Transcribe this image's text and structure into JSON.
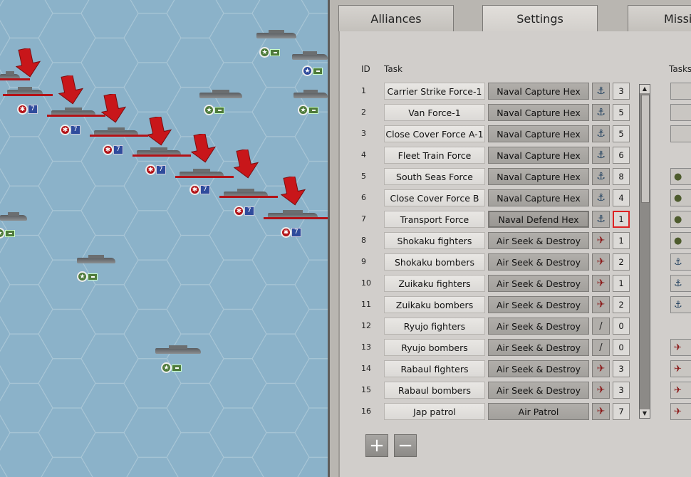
{
  "tabs": [
    "Alliances",
    "Settings",
    "Missi"
  ],
  "table": {
    "col_id": "ID",
    "col_task": "Task",
    "col_tasks_right": "Tasks",
    "rows": [
      {
        "id": "1",
        "name": "Carrier Strike Force-1",
        "type": "Naval Capture Hex",
        "icon": "anchor-icon",
        "count": "3"
      },
      {
        "id": "2",
        "name": "Van Force-1",
        "type": "Naval Capture Hex",
        "icon": "anchor-icon",
        "count": "5"
      },
      {
        "id": "3",
        "name": "Close Cover Force A-1",
        "type": "Naval Capture Hex",
        "icon": "anchor-icon",
        "count": "5"
      },
      {
        "id": "4",
        "name": "Fleet Train Force",
        "type": "Naval Capture Hex",
        "icon": "anchor-icon",
        "count": "6"
      },
      {
        "id": "5",
        "name": "South Seas Force",
        "type": "Naval Capture Hex",
        "icon": "anchor-icon",
        "count": "8"
      },
      {
        "id": "6",
        "name": "Close Cover Force B",
        "type": "Naval Capture Hex",
        "icon": "anchor-icon",
        "count": "4"
      },
      {
        "id": "7",
        "name": "Transport Force",
        "type": "Naval Defend Hex",
        "icon": "anchor-icon",
        "count": "1"
      },
      {
        "id": "8",
        "name": "Shokaku fighters",
        "type": "Air Seek & Destroy",
        "icon": "aircraft-icon",
        "count": "1"
      },
      {
        "id": "9",
        "name": "Shokaku bombers",
        "type": "Air Seek & Destroy",
        "icon": "aircraft-icon",
        "count": "2"
      },
      {
        "id": "10",
        "name": "Zuikaku fighters",
        "type": "Air Seek & Destroy",
        "icon": "aircraft-icon",
        "count": "1"
      },
      {
        "id": "11",
        "name": "Zuikaku bombers",
        "type": "Air Seek & Destroy",
        "icon": "aircraft-icon",
        "count": "2"
      },
      {
        "id": "12",
        "name": "Ryujo fighters",
        "type": "Air Seek & Destroy",
        "icon": "slash-icon",
        "count": "0"
      },
      {
        "id": "13",
        "name": "Ryujo bombers",
        "type": "Air Seek & Destroy",
        "icon": "slash-icon",
        "count": "0"
      },
      {
        "id": "14",
        "name": "Rabaul fighters",
        "type": "Air Seek & Destroy",
        "icon": "aircraft-icon",
        "count": "3"
      },
      {
        "id": "15",
        "name": "Rabaul bombers",
        "type": "Air Seek & Destroy",
        "icon": "aircraft-icon",
        "count": "3"
      },
      {
        "id": "16",
        "name": "Jap patrol",
        "type": "Air Patrol",
        "icon": "aircraft-icon",
        "count": "7"
      }
    ]
  },
  "map_units": {
    "japanese_badge_value": "7"
  },
  "buttons": {
    "add": "+",
    "remove": "−"
  },
  "colors": {
    "sea": "#8bb2c9",
    "arrow": "#c8161a",
    "highlight": "#d22222"
  }
}
